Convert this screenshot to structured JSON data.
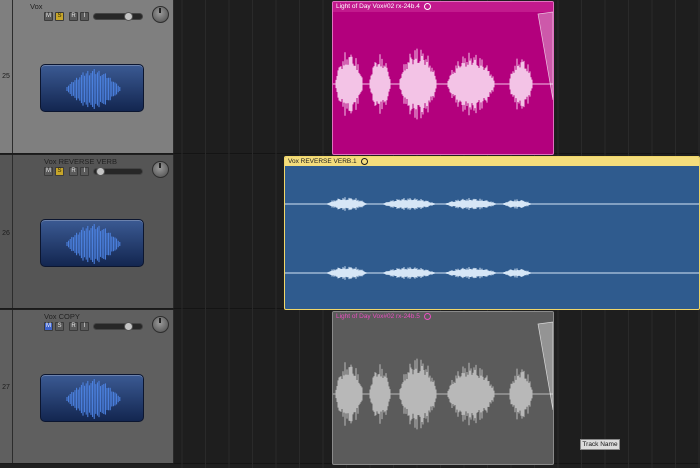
{
  "tracks": [
    {
      "number": "25",
      "name": "Vox",
      "buttons": [
        "M",
        "S",
        "R",
        "I"
      ],
      "mute_on": false,
      "solo_on": true,
      "volume_level": 0.72,
      "header_color": "#7f7f7f"
    },
    {
      "number": "26",
      "name": "Vox REVERSE VERB",
      "buttons": [
        "M",
        "S",
        "R",
        "I"
      ],
      "mute_on": false,
      "solo_on": true,
      "volume_level": 0.06,
      "header_color": "#555555"
    },
    {
      "number": "27",
      "name": "Vox COPY",
      "buttons": [
        "M",
        "S",
        "R",
        "I"
      ],
      "mute_on": true,
      "solo_on": false,
      "volume_level": 0.72,
      "header_color": "#5f5f5f"
    }
  ],
  "regions": [
    {
      "track": "25",
      "title": "Light of Day Vox#02 rx-24b.4",
      "fill": "#b3007d",
      "border": "#e06fbf",
      "header": "#c21a8d",
      "wave": "#f3c3e6",
      "text": "#ffffff",
      "muted": false
    },
    {
      "track": "26",
      "title": "Vox REVERSE VERB.1",
      "fill": "#2f5b8e",
      "border": "#f0d66a",
      "header": "#f4dd7c",
      "wave": "#d6e6f6",
      "text": "#1d1d1d",
      "muted": false
    },
    {
      "track": "27",
      "title": "Light of Day Vox#02 rx-24b.5",
      "fill": "#5b5b5b",
      "border": "#8a8a8a",
      "header": "#5b5b5b",
      "wave": "#b8b8b8",
      "text": "#e94fc0",
      "muted": true
    }
  ],
  "tooltip": {
    "text": "Track Name"
  },
  "icons": {
    "loop": "loop-icon",
    "knob": "pan-knob",
    "track_icon": "waveform-icon"
  }
}
